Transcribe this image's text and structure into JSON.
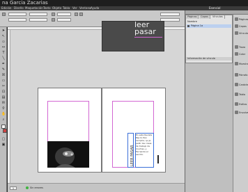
{
  "window": {
    "title": "na Garcia Zacarias"
  },
  "menu": {
    "items": [
      "Edición",
      "Diseño",
      "Maquetación",
      "Texto",
      "Objeto",
      "Tabla",
      "Ver",
      "Ventana",
      "Ayuda"
    ]
  },
  "control_bar": {
    "zoom": "Esencial",
    "workspace_label": "Esencial"
  },
  "pages_panel": {
    "tabs": [
      "Páginas",
      "Capas",
      "Vínculos"
    ],
    "header": "Nombre",
    "layer_name": "Página 1a",
    "info_label": "Información de vínculo"
  },
  "dock": {
    "items": [
      "Páginas",
      "Capas",
      "Vínculos",
      "Trazo",
      "Color",
      "Muestras",
      "Párrafo",
      "Carácter",
      "Tabla",
      "Estilos",
      "Envolvente"
    ]
  },
  "document": {
    "spine_text": "LEER PASAR",
    "body_text": "En esta Revista Pap to Pan recopila, qu ja pellic las cosas de trabajo de muchas, y Fernanda el escrito.",
    "ad_title_line1": "leer",
    "ad_title_line2": "pasar"
  },
  "status": {
    "page": "1",
    "state": "Sin errores"
  },
  "colors": {
    "accent": "#d266d2",
    "cover": "#4a4a4a",
    "titlebar": "#1e1e1e"
  }
}
